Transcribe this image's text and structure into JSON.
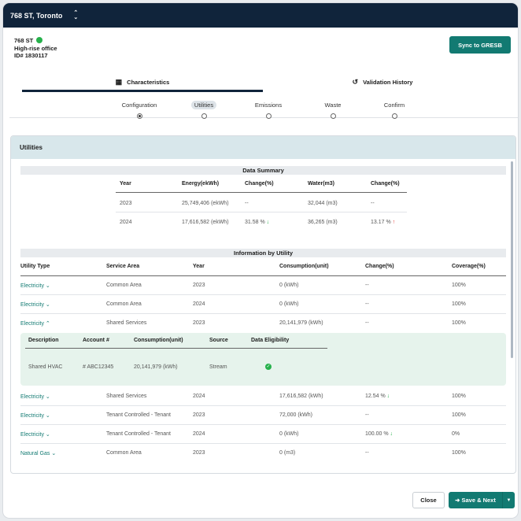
{
  "header": {
    "title": "768 ST, Toronto"
  },
  "building": {
    "name": "768 ST",
    "type": "High-rise office",
    "id": "ID# 1830117"
  },
  "actions": {
    "sync": "Sync to GRESB",
    "close": "Close",
    "save_next": "Save & Next"
  },
  "tabs": [
    {
      "label": "Characteristics",
      "icon": "building-icon"
    },
    {
      "label": "Validation History",
      "icon": "history-icon"
    }
  ],
  "steps": [
    {
      "label": "Configuration",
      "state": "completed"
    },
    {
      "label": "Utilities",
      "state": "current"
    },
    {
      "label": "Emissions",
      "state": "pending"
    },
    {
      "label": "Waste",
      "state": "pending"
    },
    {
      "label": "Confirm",
      "state": "pending"
    }
  ],
  "panel_title": "Utilities",
  "summary": {
    "title": "Data Summary",
    "headers": [
      "Year",
      "Energy(ekWh)",
      "Change(%)",
      "Water(m3)",
      "Change(%)"
    ],
    "rows": [
      {
        "year": "2023",
        "energy": "25,749,406 (ekWh)",
        "energy_change": "--",
        "water": "32,044 (m3)",
        "water_change": "--"
      },
      {
        "year": "2024",
        "energy": "17,616,582 (ekWh)",
        "energy_change": "31.58 %",
        "water": "36,265 (m3)",
        "water_change": "13.17 %"
      }
    ]
  },
  "by_utility": {
    "title": "Information by Utility",
    "headers": [
      "Utility Type",
      "Service Area",
      "Year",
      "Consumption(unit)",
      "Change(%)",
      "Coverage(%)"
    ],
    "rows": [
      {
        "type": "Electricity",
        "area": "Common Area",
        "year": "2023",
        "consumption": "0 (kWh)",
        "change": "--",
        "coverage": "100%"
      },
      {
        "type": "Electricity",
        "area": "Common Area",
        "year": "2024",
        "consumption": "0 (kWh)",
        "change": "--",
        "coverage": "100%"
      },
      {
        "type": "Electricity",
        "area": "Shared Services",
        "year": "2023",
        "consumption": "20,141,979 (kWh)",
        "change": "--",
        "coverage": "100%"
      },
      {
        "type": "Electricity",
        "area": "Shared Services",
        "year": "2024",
        "consumption": "17,616,582 (kWh)",
        "change": "12.54 %",
        "coverage": "100%"
      },
      {
        "type": "Electricity",
        "area": "Tenant Controlled - Tenant",
        "year": "2023",
        "consumption": "72,000 (kWh)",
        "change": "--",
        "coverage": "100%"
      },
      {
        "type": "Electricity",
        "area": "Tenant Controlled - Tenant",
        "year": "2024",
        "consumption": "0 (kWh)",
        "change": "100.00 %",
        "coverage": "0%"
      },
      {
        "type": "Natural Gas",
        "area": "Common Area",
        "year": "2023",
        "consumption": "0 (m3)",
        "change": "--",
        "coverage": "100%"
      }
    ],
    "detail": {
      "headers": [
        "Description",
        "Account #",
        "Consumption(unit)",
        "Source",
        "Data Eligibility"
      ],
      "row": {
        "description": "Shared HVAC",
        "account": "# ABC12345",
        "consumption": "20,141,979 (kWh)",
        "source": "Stream"
      }
    }
  },
  "colors": {
    "accent": "#127a72",
    "header_bg": "#10243b",
    "up_good": "#26b14b",
    "up_bad": "#e53935"
  }
}
